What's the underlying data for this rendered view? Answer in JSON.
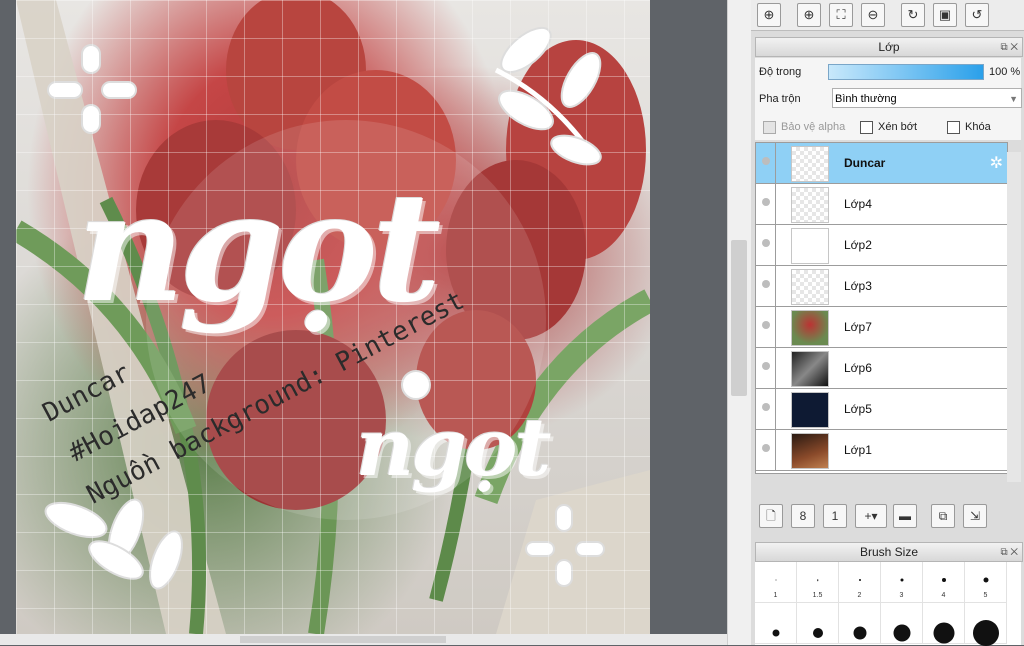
{
  "artwork": {
    "big_word": "ngọt",
    "small_word": "ngọt",
    "diagonal_lines": [
      "Duncar",
      "#Hoidap247",
      "Nguồn background: Pinterest"
    ]
  },
  "toolbar": {
    "icons": [
      "zoom-fit-icon",
      "zoom-in-icon",
      "fit-window-icon",
      "zoom-out-icon",
      "rotate-icon",
      "fullscreen-icon",
      "reset-rotation-icon"
    ]
  },
  "layer_panel": {
    "title": "Lớp",
    "opacity_label": "Độ trong",
    "opacity_value": "100 %",
    "opacity_fraction": 1.0,
    "blend_label": "Pha trộn",
    "blend_value": "Bình thường",
    "protect_alpha_label": "Bảo vệ alpha",
    "clipping_label": "Xén bớt",
    "lock_label": "Khóa",
    "layers": [
      {
        "name": "Duncar",
        "selected": true
      },
      {
        "name": "Lớp4",
        "selected": false
      },
      {
        "name": "Lớp2",
        "selected": false
      },
      {
        "name": "Lớp3",
        "selected": false
      },
      {
        "name": "Lớp7",
        "selected": false
      },
      {
        "name": "Lớp6",
        "selected": false
      },
      {
        "name": "Lớp5",
        "selected": false
      },
      {
        "name": "Lớp1",
        "selected": false
      }
    ]
  },
  "brush_panel": {
    "title": "Brush Size",
    "sizes": [
      "1",
      "1.5",
      "2",
      "3",
      "4",
      "5"
    ]
  },
  "colors": {
    "selected_layer": "#8fd0f5",
    "opacity_bar": "#2aa0ea"
  }
}
